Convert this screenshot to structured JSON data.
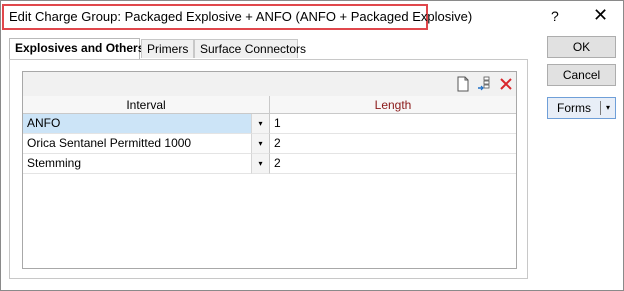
{
  "window": {
    "title": "Edit Charge Group: Packaged Explosive + ANFO (ANFO + Packaged Explosive)",
    "help_glyph": "?",
    "close_glyph": "✕",
    "highlight_color": "#e0474c"
  },
  "tabs": [
    {
      "label": "Explosives and Others",
      "active": true
    },
    {
      "label": "Primers",
      "active": false
    },
    {
      "label": "Surface Connectors",
      "active": false
    }
  ],
  "toolbar": {
    "icons": [
      "new-document-icon",
      "insert-row-icon",
      "delete-icon"
    ]
  },
  "grid": {
    "columns": [
      "Interval",
      "Length"
    ],
    "dropdown_glyph": "▾",
    "rows": [
      {
        "interval": "ANFO",
        "length": "1",
        "selected": true
      },
      {
        "interval": "Orica Sentanel Permitted 1000",
        "length": "2",
        "selected": false
      },
      {
        "interval": "Stemming",
        "length": "2",
        "selected": false
      }
    ]
  },
  "buttons": {
    "ok": "OK",
    "cancel": "Cancel",
    "forms": "Forms",
    "forms_arrow": "▾"
  }
}
